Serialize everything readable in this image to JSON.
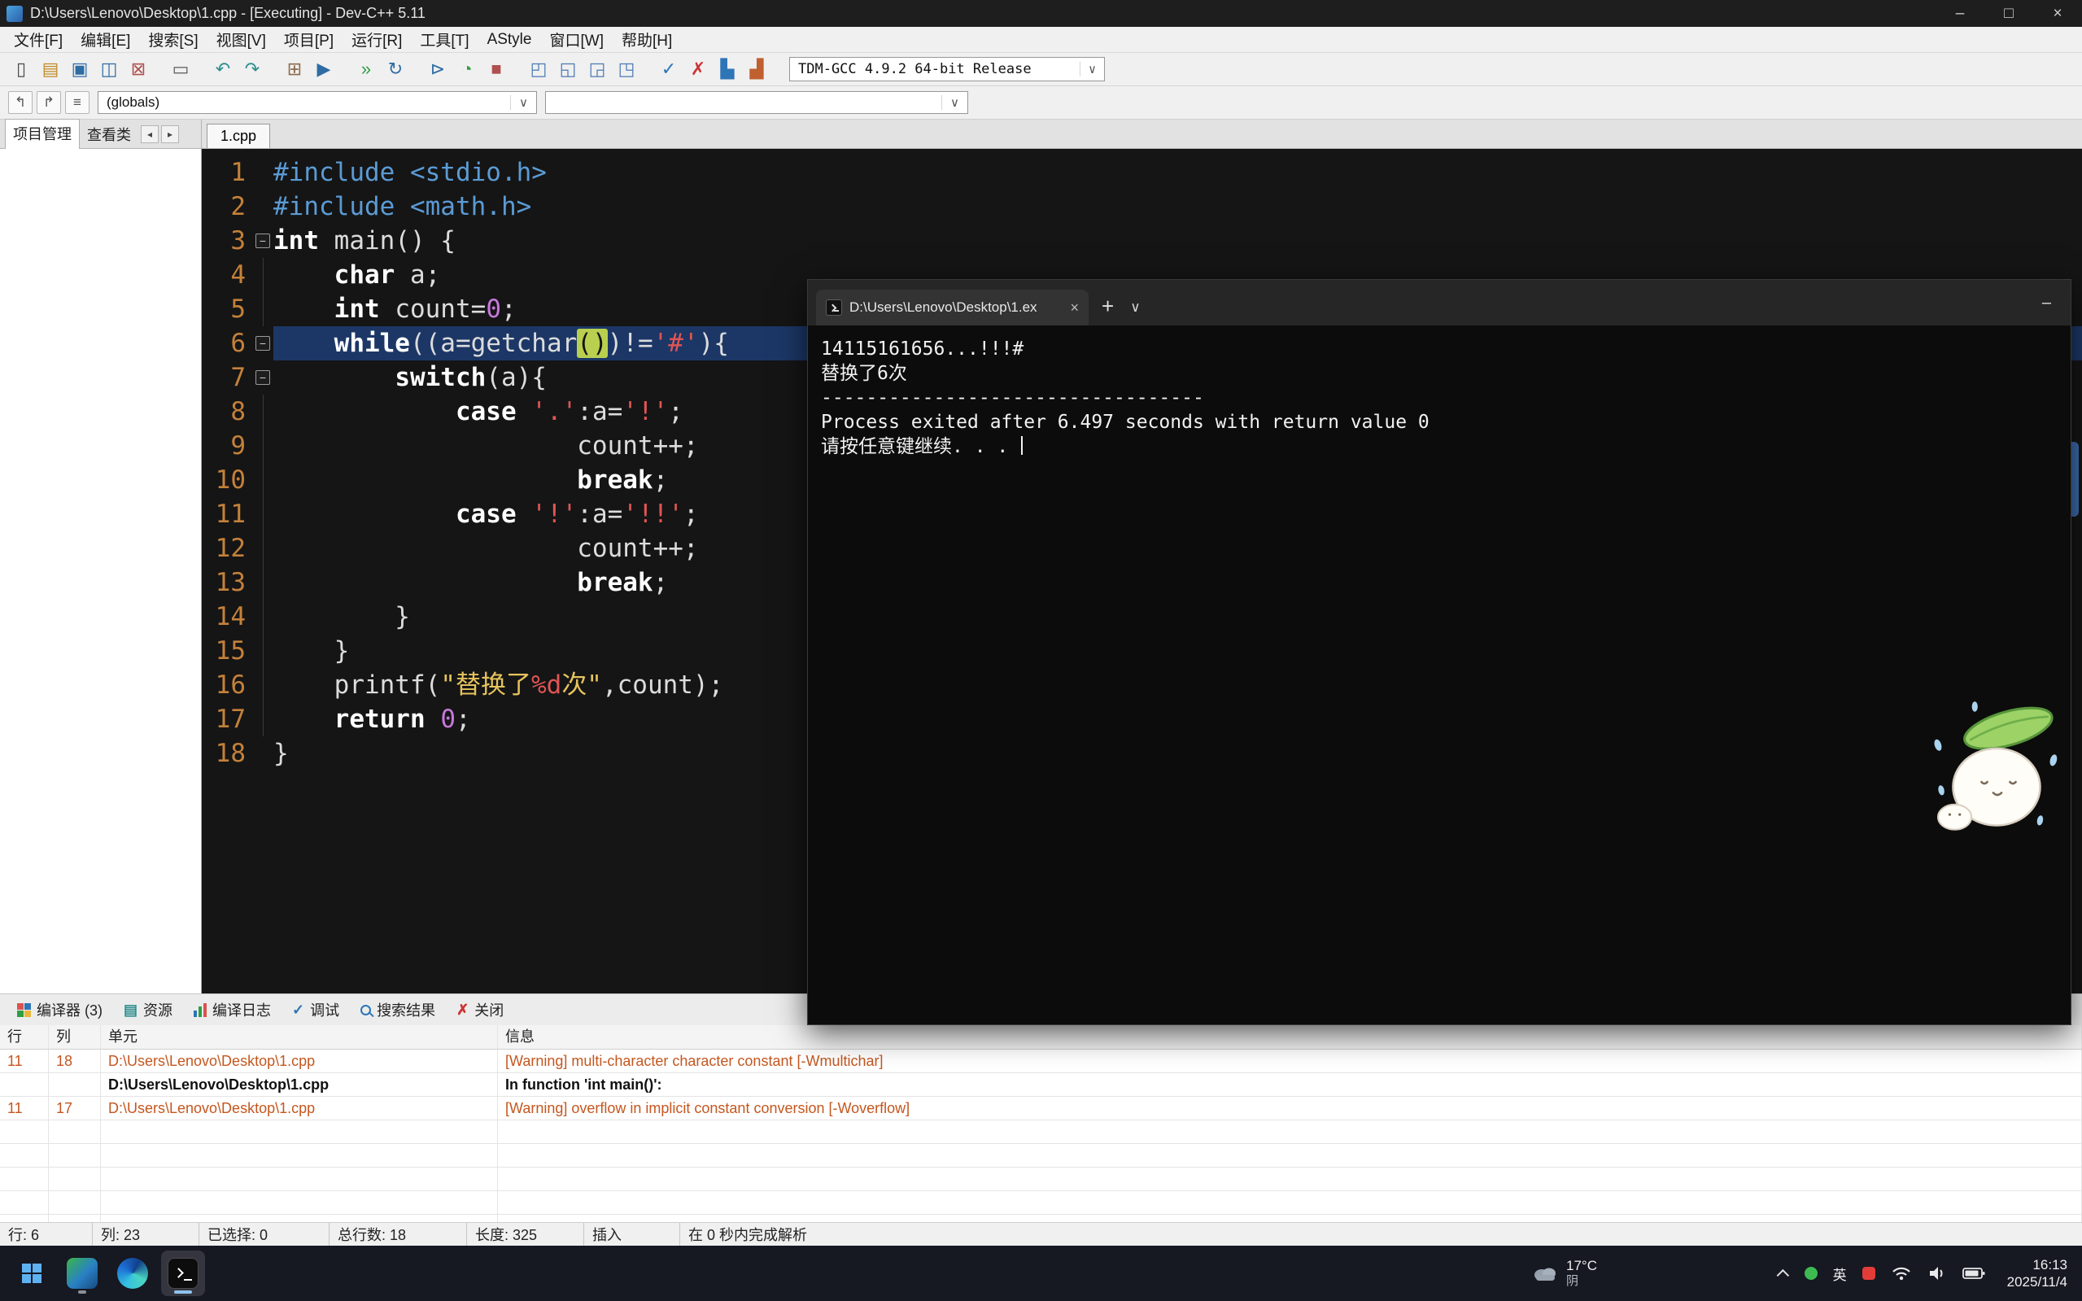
{
  "window": {
    "title": "D:\\Users\\Lenovo\\Desktop\\1.cpp - [Executing] - Dev-C++ 5.11",
    "controls": {
      "min": "–",
      "max": "□",
      "close": "×"
    }
  },
  "menu": {
    "items": [
      {
        "id": "file",
        "label": "文件[F]"
      },
      {
        "id": "edit",
        "label": "编辑[E]"
      },
      {
        "id": "search",
        "label": "搜索[S]"
      },
      {
        "id": "view",
        "label": "视图[V]"
      },
      {
        "id": "project",
        "label": "项目[P]"
      },
      {
        "id": "run",
        "label": "运行[R]"
      },
      {
        "id": "tools",
        "label": "工具[T]"
      },
      {
        "id": "astyle",
        "label": "AStyle"
      },
      {
        "id": "window",
        "label": "窗口[W]"
      },
      {
        "id": "help",
        "label": "帮助[H]"
      }
    ]
  },
  "toolbar": {
    "compiler": "TDM-GCC 4.9.2 64-bit Release",
    "chevron": "∨",
    "icons": [
      {
        "n": "new-file",
        "g": "▯",
        "c": "#4a4a4a"
      },
      {
        "n": "open-file",
        "g": "▤",
        "c": "#c08a28"
      },
      {
        "n": "save-file",
        "g": "▣",
        "c": "#2e6da4"
      },
      {
        "n": "save-all",
        "g": "◫",
        "c": "#2e6da4"
      },
      {
        "n": "close-file",
        "g": "⊠",
        "c": "#b05050"
      },
      {
        "n": "print",
        "g": "▭",
        "c": "#5a5a5a",
        "sep": true
      },
      {
        "n": "undo",
        "g": "↶",
        "c": "#2f8f8f",
        "sep": true
      },
      {
        "n": "redo",
        "g": "↷",
        "c": "#2f8f8f"
      },
      {
        "n": "compile",
        "g": "⊞",
        "c": "#8a6a4a",
        "sep": true
      },
      {
        "n": "run",
        "g": "▶",
        "c": "#2e6da4"
      },
      {
        "n": "compile-run",
        "g": "»",
        "c": "#2f9e44",
        "sep": true
      },
      {
        "n": "rebuild-all",
        "g": "↻",
        "c": "#2e6da4"
      },
      {
        "n": "debug",
        "g": "⊳",
        "c": "#2e6da4",
        "sep": true
      },
      {
        "n": "profile",
        "g": "◔",
        "c": "#2f9e44"
      },
      {
        "n": "stop",
        "g": "■",
        "c": "#b05050"
      },
      {
        "n": "toggle-project-panel",
        "g": "◰",
        "c": "#4a7ab5",
        "sep": true
      },
      {
        "n": "toggle-report-panel",
        "g": "◱",
        "c": "#4a7ab5"
      },
      {
        "n": "split-horizontal",
        "g": "◲",
        "c": "#4a7ab5"
      },
      {
        "n": "split-vertical",
        "g": "◳",
        "c": "#4a7ab5"
      },
      {
        "n": "syntax-check",
        "g": "✓",
        "c": "#2e75b6",
        "sep": true
      },
      {
        "n": "abort-compile",
        "g": "✗",
        "c": "#cc3333"
      },
      {
        "n": "profile-chart",
        "g": "▙",
        "c": "#2e75b6"
      },
      {
        "n": "clear-profile",
        "g": "▟",
        "c": "#c06030"
      }
    ]
  },
  "nav": {
    "buttons": [
      {
        "n": "goto-back",
        "g": "↰"
      },
      {
        "n": "goto-forward",
        "g": "↱"
      },
      {
        "n": "member-list",
        "g": "≡"
      }
    ],
    "globals": "(globals)",
    "scope": "",
    "chevron": "∨"
  },
  "panels": {
    "left_tabs": [
      {
        "id": "project-manager",
        "label": "项目管理"
      },
      {
        "id": "class-viewer",
        "label": "查看类"
      }
    ],
    "arrows": {
      "left": "◂",
      "right": "▸"
    },
    "editor_tab": "1.cpp"
  },
  "editor": {
    "fold_glyph": "−",
    "lines": [
      {
        "n": 1,
        "fold": "",
        "seg": [
          {
            "t": "#include <stdio.h>",
            "c": "pp"
          }
        ]
      },
      {
        "n": 2,
        "fold": "",
        "seg": [
          {
            "t": "#include <math.h>",
            "c": "pp"
          }
        ]
      },
      {
        "n": 3,
        "fold": "box",
        "seg": [
          {
            "t": "int",
            "c": "kw"
          },
          {
            "t": " main() {",
            "c": "pl"
          }
        ]
      },
      {
        "n": 4,
        "fold": "line",
        "seg": [
          {
            "t": "    ",
            "c": "pl"
          },
          {
            "t": "char",
            "c": "kw"
          },
          {
            "t": " a;",
            "c": "pl"
          }
        ]
      },
      {
        "n": 5,
        "fold": "line",
        "seg": [
          {
            "t": "    ",
            "c": "pl"
          },
          {
            "t": "int",
            "c": "kw"
          },
          {
            "t": " count=",
            "c": "pl"
          },
          {
            "t": "0",
            "c": "num"
          },
          {
            "t": ";",
            "c": "pl"
          }
        ]
      },
      {
        "n": 6,
        "fold": "box",
        "cur": true,
        "seg": [
          {
            "t": "    ",
            "c": "pl"
          },
          {
            "t": "while",
            "c": "kw"
          },
          {
            "t": "((a=getchar",
            "c": "pl"
          },
          {
            "t": "()",
            "c": "brk"
          },
          {
            "t": ")!=",
            "c": "pl"
          },
          {
            "t": "'#'",
            "c": "chr"
          },
          {
            "t": "){",
            "c": "pl"
          }
        ]
      },
      {
        "n": 7,
        "fold": "box",
        "seg": [
          {
            "t": "        ",
            "c": "pl"
          },
          {
            "t": "switch",
            "c": "kw"
          },
          {
            "t": "(a){",
            "c": "pl"
          }
        ]
      },
      {
        "n": 8,
        "fold": "line",
        "seg": [
          {
            "t": "            ",
            "c": "pl"
          },
          {
            "t": "case",
            "c": "kw"
          },
          {
            "t": " ",
            "c": "pl"
          },
          {
            "t": "'.'",
            "c": "chr"
          },
          {
            "t": ":a=",
            "c": "pl"
          },
          {
            "t": "'!'",
            "c": "chr"
          },
          {
            "t": ";",
            "c": "pl"
          }
        ]
      },
      {
        "n": 9,
        "fold": "line",
        "seg": [
          {
            "t": "                    count++;",
            "c": "pl"
          }
        ]
      },
      {
        "n": 10,
        "fold": "line",
        "seg": [
          {
            "t": "                    ",
            "c": "pl"
          },
          {
            "t": "break",
            "c": "kw"
          },
          {
            "t": ";",
            "c": "pl"
          }
        ]
      },
      {
        "n": 11,
        "fold": "line",
        "seg": [
          {
            "t": "            ",
            "c": "pl"
          },
          {
            "t": "case",
            "c": "kw"
          },
          {
            "t": " ",
            "c": "pl"
          },
          {
            "t": "'!'",
            "c": "chr"
          },
          {
            "t": ":a=",
            "c": "pl"
          },
          {
            "t": "'!!'",
            "c": "chr"
          },
          {
            "t": ";",
            "c": "pl"
          }
        ]
      },
      {
        "n": 12,
        "fold": "line",
        "seg": [
          {
            "t": "                    count++;",
            "c": "pl"
          }
        ]
      },
      {
        "n": 13,
        "fold": "line",
        "seg": [
          {
            "t": "                    ",
            "c": "pl"
          },
          {
            "t": "break",
            "c": "kw"
          },
          {
            "t": ";",
            "c": "pl"
          }
        ]
      },
      {
        "n": 14,
        "fold": "line",
        "seg": [
          {
            "t": "        }",
            "c": "pl"
          }
        ]
      },
      {
        "n": 15,
        "fold": "line",
        "seg": [
          {
            "t": "    }",
            "c": "pl"
          }
        ]
      },
      {
        "n": 16,
        "fold": "line",
        "seg": [
          {
            "t": "    printf(",
            "c": "pl"
          },
          {
            "t": "\"替换了",
            "c": "str"
          },
          {
            "t": "%d",
            "c": "fmt"
          },
          {
            "t": "次\"",
            "c": "str"
          },
          {
            "t": ",count);",
            "c": "pl"
          }
        ]
      },
      {
        "n": 17,
        "fold": "line",
        "seg": [
          {
            "t": "    ",
            "c": "pl"
          },
          {
            "t": "return",
            "c": "kw"
          },
          {
            "t": " ",
            "c": "pl"
          },
          {
            "t": "0",
            "c": "num"
          },
          {
            "t": ";",
            "c": "pl"
          }
        ]
      },
      {
        "n": 18,
        "fold": "",
        "seg": [
          {
            "t": "}",
            "c": "pl"
          }
        ]
      }
    ]
  },
  "console": {
    "tab_title": "D:\\Users\\Lenovo\\Desktop\\1.ex",
    "close_glyph": "×",
    "plus_glyph": "+",
    "chevron_glyph": "∨",
    "min_glyph": "–",
    "lines": [
      "14115161656...!!!#",
      "替换了6次",
      "----------------------------------",
      "Process exited after 6.497 seconds with return value 0",
      "请按任意键继续. . . "
    ]
  },
  "bottom": {
    "tabs": [
      {
        "id": "compiler",
        "label": "编译器 (3)",
        "icon": "grid"
      },
      {
        "id": "resources",
        "label": "资源",
        "icon": "page",
        "g": "▤"
      },
      {
        "id": "compile-log",
        "label": "编译日志",
        "icon": "bars"
      },
      {
        "id": "debug",
        "label": "调试",
        "icon": "check",
        "g": "✓"
      },
      {
        "id": "search-results",
        "label": "搜索结果",
        "icon": "search"
      },
      {
        "id": "close",
        "label": "关闭",
        "icon": "close",
        "g": "✗"
      }
    ],
    "table": {
      "headers": [
        "行",
        "列",
        "单元",
        "信息"
      ],
      "rows": [
        {
          "line": "11",
          "col": "18",
          "unit": "D:\\Users\\Lenovo\\Desktop\\1.cpp",
          "msg": "[Warning] multi-character character constant [-Wmultichar]",
          "style": "warn"
        },
        {
          "line": "",
          "col": "",
          "unit": "D:\\Users\\Lenovo\\Desktop\\1.cpp",
          "msg": "In function 'int main()':",
          "style": "bold"
        },
        {
          "line": "11",
          "col": "17",
          "unit": "D:\\Users\\Lenovo\\Desktop\\1.cpp",
          "msg": "[Warning] overflow in implicit constant conversion [-Woverflow]",
          "style": "warn"
        }
      ]
    }
  },
  "statusbar": {
    "items": [
      {
        "id": "line",
        "label": "行:  6"
      },
      {
        "id": "col",
        "label": "列:  23"
      },
      {
        "id": "selected",
        "label": "已选择:  0"
      },
      {
        "id": "total-lines",
        "label": "总行数:  18"
      },
      {
        "id": "length",
        "label": "长度:  325"
      },
      {
        "id": "mode",
        "label": "插入"
      },
      {
        "id": "parse",
        "label": "在 0 秒内完成解析"
      }
    ]
  },
  "taskbar": {
    "weather": {
      "temp": "17°C",
      "cond": "阴"
    },
    "input": "英",
    "clock": {
      "time": "16:13",
      "date": "2025/11/4"
    }
  }
}
